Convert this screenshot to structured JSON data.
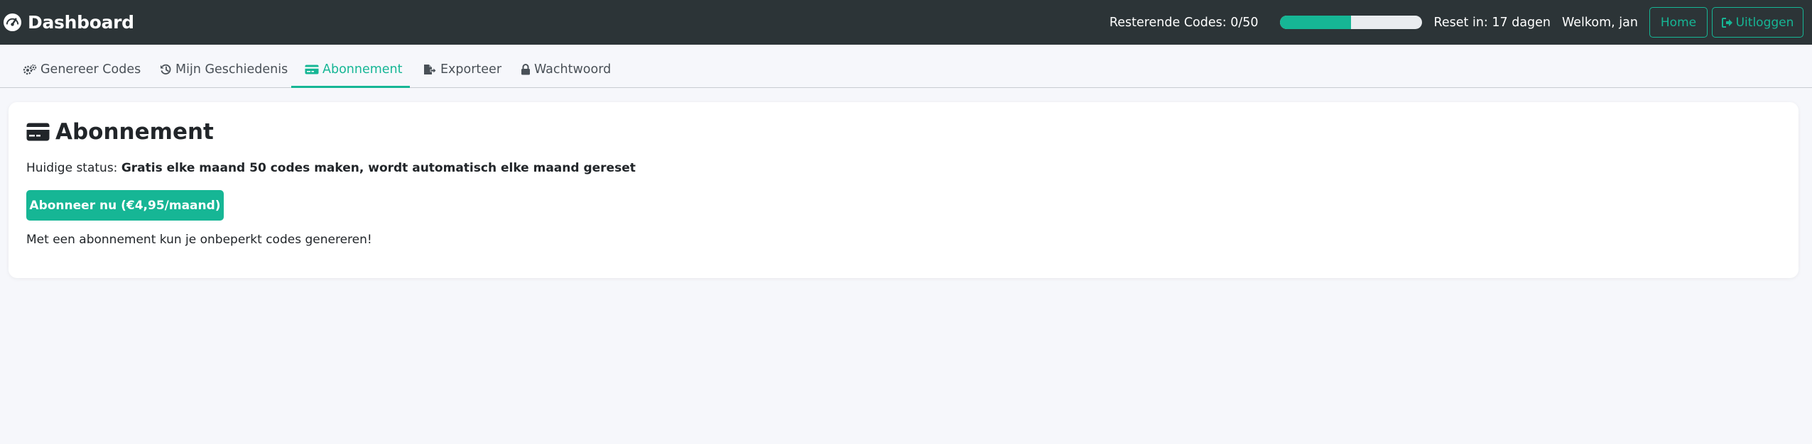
{
  "header": {
    "title": "Dashboard",
    "codes_text": "Resterende Codes: 0/50",
    "codes_progress_percent": 50,
    "reset_text": "Reset in: 17 dagen",
    "welcome_text": "Welkom, jan",
    "home_label": "Home",
    "logout_label": "Uitloggen"
  },
  "tabs": [
    {
      "label": "Genereer Codes",
      "icon": "cogs-icon"
    },
    {
      "label": "Mijn Geschiedenis",
      "icon": "history-icon"
    },
    {
      "label": "Abonnement",
      "icon": "credit-card-icon",
      "active": true
    },
    {
      "label": "Exporteer",
      "icon": "file-export-icon"
    },
    {
      "label": "Wachtwoord",
      "icon": "lock-icon"
    }
  ],
  "card": {
    "title": "Abonnement",
    "status_label": "Huidige status:",
    "status_value": "Gratis elke maand 50 codes maken, wordt automatisch elke maand gereset",
    "subscribe_label": "Abonneer nu (€4,95/maand)",
    "info_text": "Met een abonnement kun je onbeperkt codes genereren!"
  },
  "colors": {
    "accent": "#16b695",
    "topbar": "#2c3437",
    "background": "#f6f7fb"
  }
}
